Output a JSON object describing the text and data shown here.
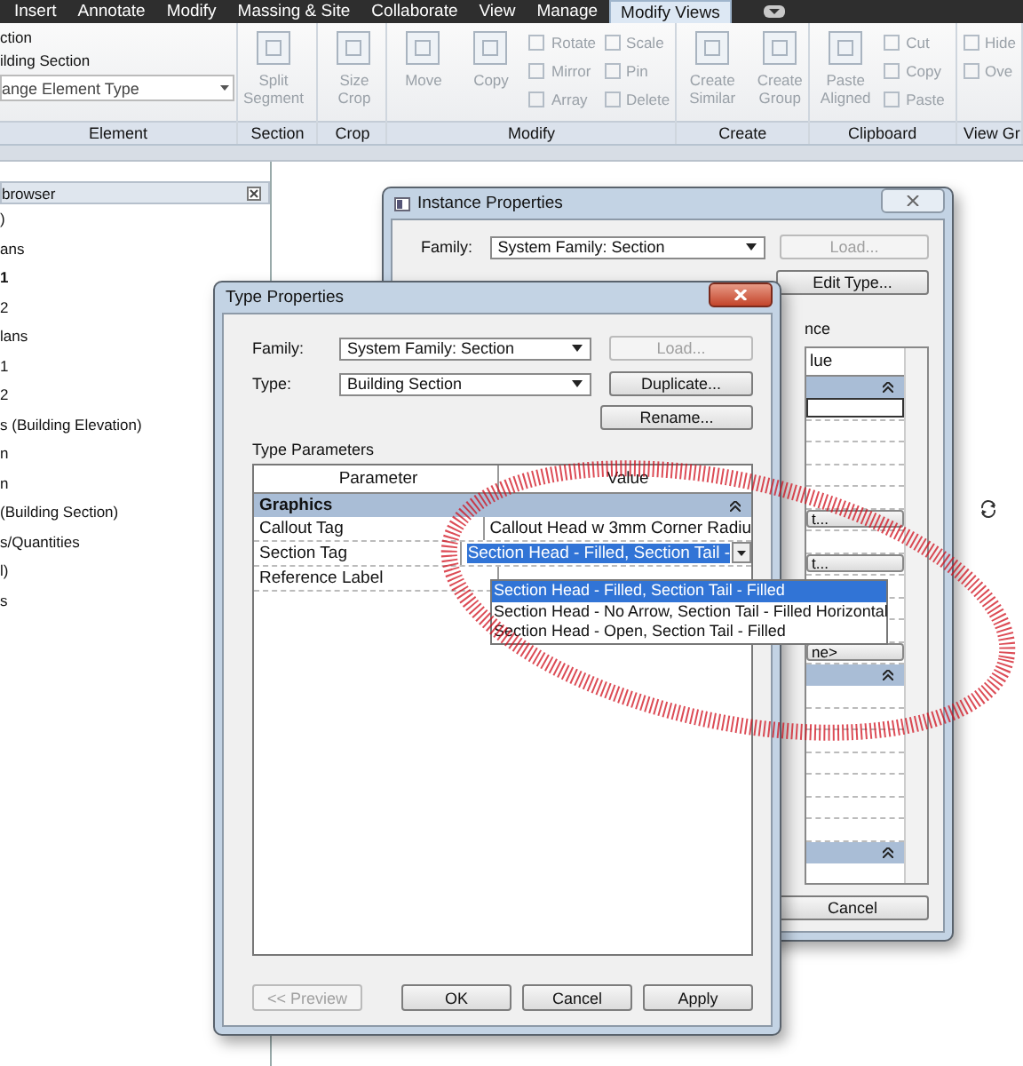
{
  "ribbon_tabs": [
    {
      "label": "Insert",
      "selected": false
    },
    {
      "label": "Annotate",
      "selected": false
    },
    {
      "label": "Modify",
      "selected": false
    },
    {
      "label": "Massing & Site",
      "selected": false
    },
    {
      "label": "Collaborate",
      "selected": false
    },
    {
      "label": "View",
      "selected": false
    },
    {
      "label": "Manage",
      "selected": false
    },
    {
      "label": "Modify Views",
      "selected": true
    }
  ],
  "ribbon_panels": [
    {
      "title": "Element",
      "kind": "element",
      "lines": [
        "ction",
        "ilding Section"
      ],
      "dropdown": "ange Element Type"
    },
    {
      "title": "Section",
      "kind": "tools",
      "tools": [
        {
          "label": "Split Segment",
          "kind": "large",
          "disabled": true
        }
      ]
    },
    {
      "title": "Crop",
      "kind": "tools",
      "tools": [
        {
          "label": "Size Crop",
          "kind": "large",
          "disabled": true
        }
      ]
    },
    {
      "title": "Modify",
      "kind": "tools",
      "tools": [
        {
          "label": "Move",
          "kind": "large",
          "disabled": true
        },
        {
          "label": "Copy",
          "kind": "large",
          "disabled": true
        },
        {
          "label": "Rotate",
          "kind": "small",
          "disabled": true
        },
        {
          "label": "Mirror",
          "kind": "small",
          "disabled": true
        },
        {
          "label": "Array",
          "kind": "small",
          "disabled": true
        },
        {
          "label": "Scale",
          "kind": "small",
          "disabled": true
        },
        {
          "label": "Pin",
          "kind": "small",
          "disabled": true
        },
        {
          "label": "Delete",
          "kind": "small",
          "disabled": true
        }
      ]
    },
    {
      "title": "Create",
      "kind": "tools",
      "tools": [
        {
          "label": "Create Similar",
          "kind": "large",
          "disabled": true
        },
        {
          "label": "Create Group",
          "kind": "large",
          "disabled": true
        }
      ]
    },
    {
      "title": "Clipboard",
      "kind": "tools",
      "tools": [
        {
          "label": "Paste Aligned",
          "kind": "large",
          "disabled": true
        },
        {
          "label": "Cut",
          "kind": "small",
          "disabled": true
        },
        {
          "label": "Copy",
          "kind": "small",
          "disabled": true
        },
        {
          "label": "Paste",
          "kind": "small",
          "disabled": true
        }
      ]
    },
    {
      "title": "View Gr",
      "kind": "tools",
      "tools": [
        {
          "label": "Hide",
          "kind": "small",
          "disabled": true
        },
        {
          "label": "Ove",
          "kind": "small",
          "disabled": true
        }
      ]
    }
  ],
  "project_browser": {
    "title": "browser",
    "items": [
      {
        "label": ")",
        "selected": false
      },
      {
        "label": "ans",
        "selected": false
      },
      {
        "label": "1",
        "selected": true
      },
      {
        "label": "2",
        "selected": false
      },
      {
        "label": "lans",
        "selected": false
      },
      {
        "label": "1",
        "selected": false
      },
      {
        "label": "2",
        "selected": false
      },
      {
        "label": "s (Building Elevation)",
        "selected": false
      },
      {
        "label": "n",
        "selected": false
      },
      {
        "label": "n",
        "selected": false
      },
      {
        "label": "(Building Section)",
        "selected": false
      },
      {
        "label": "s/Quantities",
        "selected": false
      },
      {
        "label": "l)",
        "selected": false
      },
      {
        "label": "s",
        "selected": false
      }
    ]
  },
  "instance_properties": {
    "title": "Instance Properties",
    "family_label": "Family:",
    "family_value": "System Family: Section",
    "load_button": {
      "label": "Load...",
      "disabled": true
    },
    "edit_type_button": "Edit Type...",
    "parameters_label": "nce",
    "value_header": "lue",
    "row_buttons": [
      "t...",
      "t...",
      "ne>"
    ],
    "cancel_button": "Cancel"
  },
  "type_properties": {
    "title": "Type Properties",
    "family_label": "Family:",
    "family_value": "System Family: Section",
    "type_label": "Type:",
    "type_value": "Building Section",
    "load_button": {
      "label": "Load...",
      "disabled": true
    },
    "duplicate_button": "Duplicate...",
    "rename_button": "Rename...",
    "parameters_label": "Type Parameters",
    "columns": [
      "Parameter",
      "Value"
    ],
    "groups": [
      {
        "label": "Graphics",
        "expanded": true,
        "rows": [
          {
            "parameter": "Callout Tag",
            "kind": "text",
            "value": "Callout Head w 3mm Corner Radiu"
          },
          {
            "parameter": "Section Tag",
            "kind": "dropdown",
            "value": "Section Head - Filled, Section Tail -"
          },
          {
            "parameter": "Reference Label",
            "kind": "text"
          }
        ]
      }
    ],
    "dropdown_options": [
      {
        "label": "Section Head - Filled, Section Tail - Filled",
        "selected": true
      },
      {
        "label": "Section Head - No Arrow, Section Tail - Filled Horizontal",
        "selected": false
      },
      {
        "label": "Section Head - Open, Section Tail - Filled",
        "selected": false
      }
    ],
    "buttons": [
      {
        "label": "<< Preview",
        "disabled": true
      },
      {
        "label": "OK",
        "disabled": false
      },
      {
        "label": "Cancel",
        "disabled": false
      },
      {
        "label": "Apply",
        "disabled": false
      }
    ]
  }
}
